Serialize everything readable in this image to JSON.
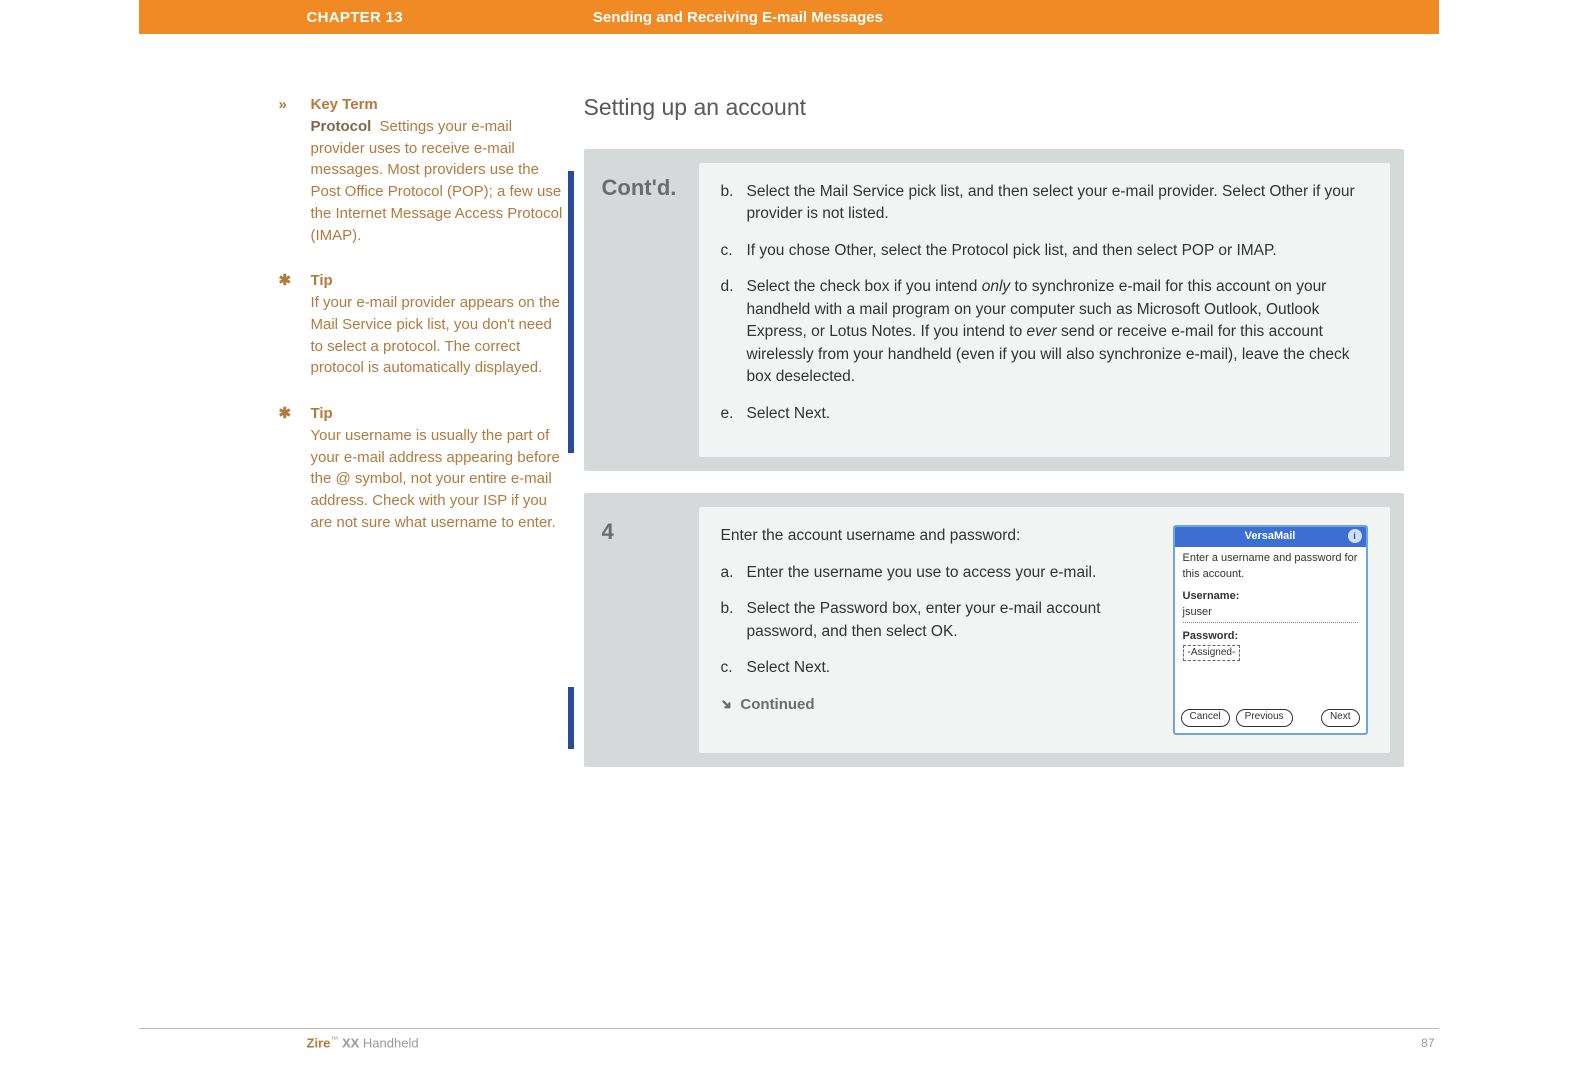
{
  "header": {
    "chapter": "CHAPTER 13",
    "title": "Sending and Receiving E-mail Messages"
  },
  "section_title": "Setting up an account",
  "sidebar": [
    {
      "marker": "»",
      "label": "Key Term",
      "sublabel": "Protocol",
      "body": "Settings your e-mail provider uses to receive e-mail messages. Most providers use the Post Office Protocol (POP); a few use the Internet Message Access Protocol (IMAP)."
    },
    {
      "marker": "✱",
      "label": "Tip",
      "sublabel": "",
      "body": "If your e-mail provider appears on the Mail Service pick list, you don't need to select a protocol. The correct protocol is automatically displayed."
    },
    {
      "marker": "✱",
      "label": "Tip",
      "sublabel": "",
      "body": "Your username is usually the part of your e-mail address appearing before the @ symbol, not your entire e-mail address. Check with your ISP if you are not sure what username to enter."
    }
  ],
  "steps": {
    "contd": {
      "label": "Cont'd.",
      "items": [
        {
          "letter": "b.",
          "text_pre": "Select the Mail Service pick list, and then select your e-mail provider. Select Other if your provider is not listed."
        },
        {
          "letter": "c.",
          "text_pre": "If you chose Other, select the Protocol pick list, and then select POP or IMAP."
        },
        {
          "letter": "d.",
          "text_pre": "Select the check box if you intend ",
          "em1": "only",
          "text_mid": " to synchronize e-mail for this account on your handheld with a mail program on your computer such as Microsoft Outlook, Outlook Express, or Lotus Notes. If you intend to ",
          "em2": "ever",
          "text_post": " send or receive e-mail for this account wirelessly from your handheld (even if you will also synchronize e-mail), leave the check box deselected."
        },
        {
          "letter": "e.",
          "text_pre": "Select Next."
        }
      ]
    },
    "step4": {
      "number": "4",
      "intro": "Enter the account username and password:",
      "items": [
        {
          "letter": "a.",
          "text": "Enter the username you use to access your e-mail."
        },
        {
          "letter": "b.",
          "text": "Select the Password box, enter your e-mail account password, and then select OK."
        },
        {
          "letter": "c.",
          "text": "Select Next."
        }
      ],
      "continued": "Continued"
    }
  },
  "versamail": {
    "title": "VersaMail",
    "prompt": "Enter a username and password for this account.",
    "username_label": "Username:",
    "username_value": "jsuser",
    "password_label": "Password:",
    "password_value": "-Assigned-",
    "btn_cancel": "Cancel",
    "btn_prev": "Previous",
    "btn_next": "Next"
  },
  "footer": {
    "brand": "Zire",
    "tm": "™",
    "model": " XX ",
    "suffix": "Handheld",
    "page": "87"
  }
}
